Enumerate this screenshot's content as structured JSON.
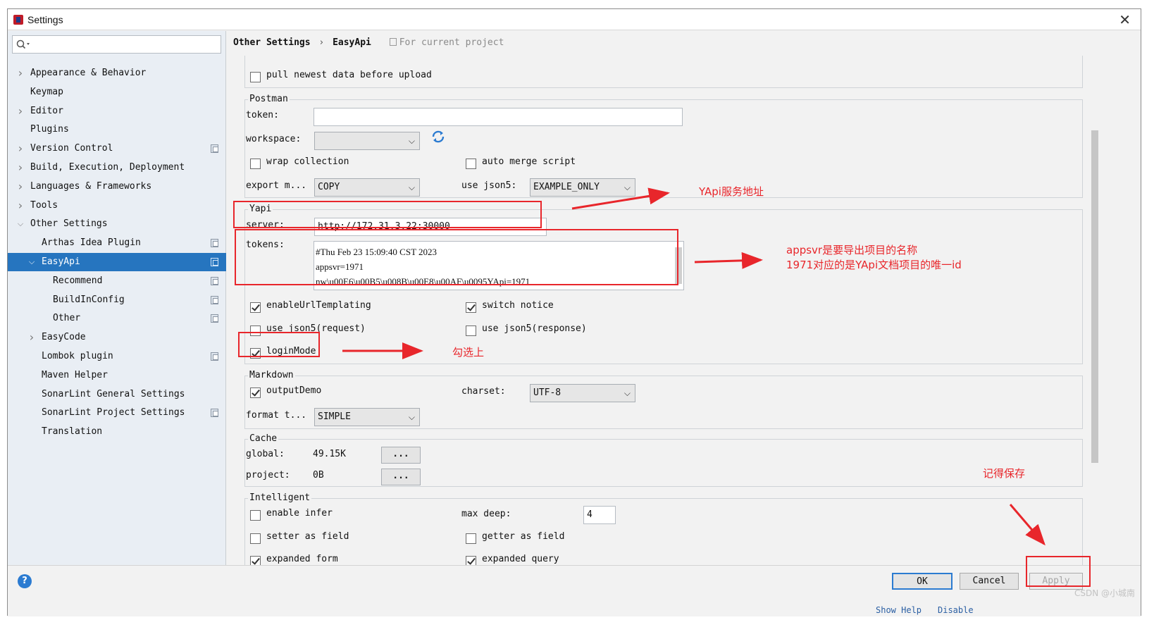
{
  "window": {
    "title": "Settings"
  },
  "search": {
    "placeholder": ""
  },
  "sidebar": {
    "items": [
      {
        "label": "Appearance & Behavior",
        "expandable": true,
        "indent": 0,
        "copy": false
      },
      {
        "label": "Keymap",
        "expandable": false,
        "indent": 0,
        "copy": false
      },
      {
        "label": "Editor",
        "expandable": true,
        "indent": 0,
        "copy": false
      },
      {
        "label": "Plugins",
        "expandable": false,
        "indent": 0,
        "copy": false
      },
      {
        "label": "Version Control",
        "expandable": true,
        "indent": 0,
        "copy": true
      },
      {
        "label": "Build, Execution, Deployment",
        "expandable": true,
        "indent": 0,
        "copy": false
      },
      {
        "label": "Languages & Frameworks",
        "expandable": true,
        "indent": 0,
        "copy": false
      },
      {
        "label": "Tools",
        "expandable": true,
        "indent": 0,
        "copy": false
      },
      {
        "label": "Other Settings",
        "expandable": true,
        "expanded": true,
        "indent": 0,
        "copy": false
      },
      {
        "label": "Arthas Idea Plugin",
        "expandable": false,
        "indent": 1,
        "copy": true
      },
      {
        "label": "EasyApi",
        "expandable": true,
        "expanded": true,
        "indent": 1,
        "copy": true,
        "selected": true
      },
      {
        "label": "Recommend",
        "expandable": false,
        "indent": 2,
        "copy": true
      },
      {
        "label": "BuildInConfig",
        "expandable": false,
        "indent": 2,
        "copy": true
      },
      {
        "label": "Other",
        "expandable": false,
        "indent": 2,
        "copy": true
      },
      {
        "label": "EasyCode",
        "expandable": true,
        "indent": 1,
        "copy": false
      },
      {
        "label": "Lombok plugin",
        "expandable": false,
        "indent": 1,
        "copy": true
      },
      {
        "label": "Maven Helper",
        "expandable": false,
        "indent": 1,
        "copy": false
      },
      {
        "label": "SonarLint General Settings",
        "expandable": false,
        "indent": 1,
        "copy": false
      },
      {
        "label": "SonarLint Project Settings",
        "expandable": false,
        "indent": 1,
        "copy": true
      },
      {
        "label": "Translation",
        "expandable": false,
        "indent": 1,
        "copy": false
      }
    ]
  },
  "breadcrumb": {
    "parent": "Other Settings",
    "sep": "›",
    "current": "EasyApi",
    "scope": "For current project"
  },
  "top": {
    "pull_label": "pull newest data before upload",
    "pull_checked": false
  },
  "postman": {
    "title": "Postman",
    "token_label": "token:",
    "token_value": "",
    "workspace_label": "workspace:",
    "workspace_value": "",
    "wrap_label": "wrap collection",
    "wrap_checked": false,
    "automerge_label": "auto merge script",
    "automerge_checked": false,
    "export_label": "export m...",
    "export_value": "COPY",
    "json5_label": "use json5:",
    "json5_value": "EXAMPLE_ONLY"
  },
  "yapi": {
    "title": "Yapi",
    "server_label": "server:",
    "server_value": "http://172.31.3.22:30000",
    "tokens_label": "tokens:",
    "tokens_lines": [
      "#Thu Feb 23 15:09:40 CST 2023",
      "appsvr=1971",
      "nw\\u00E6\\u00B5\\u008B\\u00E8\\u00AF\\u0095YApi=1971"
    ],
    "url_templating_label": "enableUrlTemplating",
    "url_templating_checked": true,
    "switch_notice_label": "switch notice",
    "switch_notice_checked": true,
    "json5_req_label": "use json5(request)",
    "json5_req_checked": false,
    "json5_resp_label": "use json5(response)",
    "json5_resp_checked": false,
    "login_label": "loginMode",
    "login_checked": true
  },
  "markdown": {
    "title": "Markdown",
    "output_label": "outputDemo",
    "output_checked": true,
    "charset_label": "charset:",
    "charset_value": "UTF-8",
    "format_label": "format t...",
    "format_value": "SIMPLE"
  },
  "cache": {
    "title": "Cache",
    "global_label": "global:",
    "global_value": "49.15K",
    "project_label": "project:",
    "project_value": "0B",
    "btn_label": "..."
  },
  "intelligent": {
    "title": "Intelligent",
    "infer_label": "enable infer",
    "infer_checked": false,
    "maxdeep_label": "max deep:",
    "maxdeep_value": "4",
    "setter_label": "setter as field",
    "setter_checked": false,
    "getter_label": "getter as field",
    "getter_checked": false,
    "expanded_form_label": "expanded form",
    "expanded_form_checked": true,
    "expanded_query_label": "expanded query",
    "expanded_query_checked": true
  },
  "annotations": {
    "server_note": "YApi服务地址",
    "tokens_note_1": "appsvr是要导出项目的名称",
    "tokens_note_2": "1971对应的是YApi文档项目的唯一id",
    "login_note": "勾选上",
    "save_note": "记得保存",
    "color": "#e8262b"
  },
  "footer": {
    "ok": "OK",
    "cancel": "Cancel",
    "apply": "Apply",
    "help_icon": "?",
    "watermark": "CSDN @小城南",
    "bottom_left": "Show Help",
    "bottom_right": "Disable"
  },
  "colors": {
    "selection": "#2675bf",
    "sidebar_bg": "#e9eef4",
    "accent": "#2b7bd1"
  }
}
